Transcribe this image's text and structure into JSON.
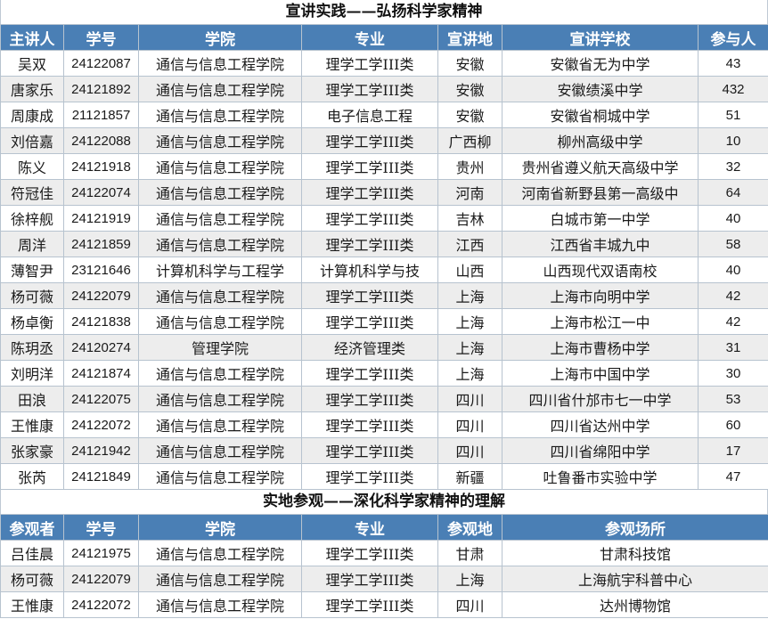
{
  "section1": {
    "title": "宣讲实践——弘扬科学家精神",
    "headers": [
      "主讲人",
      "学号",
      "学院",
      "专业",
      "宣讲地",
      "宣讲学校",
      "参与人"
    ],
    "rows": [
      [
        "吴双",
        "24122087",
        "通信与信息工程学院",
        "理学工学III类",
        "安徽",
        "安徽省无为中学",
        "43"
      ],
      [
        "唐家乐",
        "24121892",
        "通信与信息工程学院",
        "理学工学III类",
        "安徽",
        "安徽绩溪中学",
        "432"
      ],
      [
        "周康成",
        "21121857",
        "通信与信息工程学院",
        "电子信息工程",
        "安徽",
        "安徽省桐城中学",
        "51"
      ],
      [
        "刘倍嘉",
        "24122088",
        "通信与信息工程学院",
        "理学工学III类",
        "广西柳",
        "柳州高级中学",
        "10"
      ],
      [
        "陈义",
        "24121918",
        "通信与信息工程学院",
        "理学工学III类",
        "贵州",
        "贵州省遵义航天高级中学",
        "32"
      ],
      [
        "符冠佳",
        "24122074",
        "通信与信息工程学院",
        "理学工学III类",
        "河南",
        "河南省新野县第一高级中",
        "64"
      ],
      [
        "徐梓舰",
        "24121919",
        "通信与信息工程学院",
        "理学工学III类",
        "吉林",
        "白城市第一中学",
        "40"
      ],
      [
        "周洋",
        "24121859",
        "通信与信息工程学院",
        "理学工学III类",
        "江西",
        "江西省丰城九中",
        "58"
      ],
      [
        "薄智尹",
        "23121646",
        "计算机科学与工程学",
        "计算机科学与技",
        "山西",
        "山西现代双语南校",
        "40"
      ],
      [
        "杨可薇",
        "24122079",
        "通信与信息工程学院",
        "理学工学III类",
        "上海",
        "上海市向明中学",
        "42"
      ],
      [
        "杨卓衡",
        "24121838",
        "通信与信息工程学院",
        "理学工学III类",
        "上海",
        "上海市松江一中",
        "42"
      ],
      [
        "陈玥丞",
        "24120274",
        "管理学院",
        "经济管理类",
        "上海",
        "上海市曹杨中学",
        "31"
      ],
      [
        "刘明洋",
        "24121874",
        "通信与信息工程学院",
        "理学工学III类",
        "上海",
        "上海市中国中学",
        "30"
      ],
      [
        "田浪",
        "24122075",
        "通信与信息工程学院",
        "理学工学III类",
        "四川",
        "四川省什邡市七一中学",
        "53"
      ],
      [
        "王惟康",
        "24122072",
        "通信与信息工程学院",
        "理学工学III类",
        "四川",
        "四川省达州中学",
        "60"
      ],
      [
        "张家豪",
        "24121942",
        "通信与信息工程学院",
        "理学工学III类",
        "四川",
        "四川省绵阳中学",
        "17"
      ],
      [
        "张芮",
        "24121849",
        "通信与信息工程学院",
        "理学工学III类",
        "新疆",
        "吐鲁番市实验中学",
        "47"
      ]
    ]
  },
  "section2": {
    "title": "实地参观——深化科学家精神的理解",
    "headers": [
      "参观者",
      "学号",
      "学院",
      "专业",
      "参观地",
      "参观场所"
    ],
    "rows": [
      [
        "吕佳晨",
        "24121975",
        "通信与信息工程学院",
        "理学工学III类",
        "甘肃",
        "甘肃科技馆"
      ],
      [
        "杨可薇",
        "24122079",
        "通信与信息工程学院",
        "理学工学III类",
        "上海",
        "上海航宇科普中心"
      ],
      [
        "王惟康",
        "24122072",
        "通信与信息工程学院",
        "理学工学III类",
        "四川",
        "达州博物馆"
      ]
    ]
  },
  "colors": {
    "header_bg": "#4a7fb5",
    "header_text": "#ffffff",
    "alt_row": "#ededed",
    "grid": "#b7c3cf"
  }
}
